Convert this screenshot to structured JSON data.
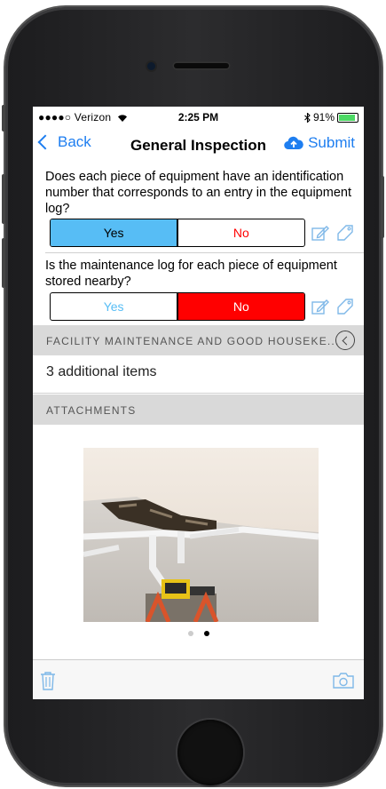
{
  "status_bar": {
    "carrier": "●●●●○ Verizon",
    "time": "2:25 PM",
    "battery": "91%"
  },
  "nav": {
    "back_label": "Back",
    "title": "General Inspection",
    "submit_label": "Submit"
  },
  "questions": [
    {
      "text": "Does each piece of equipment have an identification number that corresponds to an entry in the equipment log?",
      "yes_label": "Yes",
      "no_label": "No",
      "selected": "Yes"
    },
    {
      "text": "Is the maintenance log for each piece of equipment stored nearby?",
      "yes_label": "Yes",
      "no_label": "No",
      "selected": "No"
    }
  ],
  "sections": {
    "facility": {
      "label": "FACILITY MAINTENANCE AND GOOD HOUSEKE...",
      "additional": "3 additional items"
    },
    "attachments": {
      "label": "ATTACHMENTS"
    }
  },
  "pager": {
    "current_page": 2,
    "total_pages": 2
  },
  "icons": {
    "back": "chevron-left-icon",
    "submit": "cloud-upload-icon",
    "note": "edit-note-icon",
    "tag": "tag-icon",
    "collapse": "collapse-circle-icon",
    "trash": "trash-icon",
    "camera": "camera-icon"
  },
  "colors": {
    "accent": "#1e7ef0",
    "yes_selected": "#57bdf5",
    "no_selected": "#ff0000",
    "section_bg": "#d9d9d9"
  }
}
